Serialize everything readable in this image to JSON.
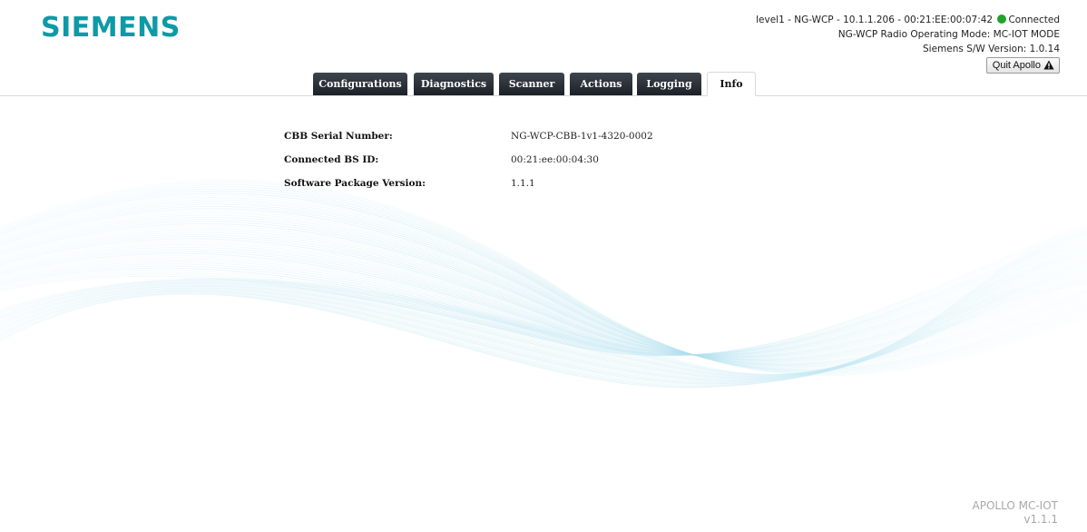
{
  "header": {
    "logo_text": "SIEMENS",
    "brand_color": "#0d9aa6",
    "connection_info": "level1 - NG-WCP - 10.1.1.206 - 00:21:EE:00:07:42",
    "connection_status": "Connected",
    "connection_status_color": "#1fa32a",
    "operating_mode": "NG-WCP Radio Operating Mode: MC-IOT MODE",
    "sw_version": "Siemens S/W Version: 1.0.14",
    "quit_label": "Quit Apollo"
  },
  "tabs": [
    {
      "label": "Configurations",
      "active": false
    },
    {
      "label": "Diagnostics",
      "active": false
    },
    {
      "label": "Scanner",
      "active": false
    },
    {
      "label": "Actions",
      "active": false
    },
    {
      "label": "Logging",
      "active": false
    },
    {
      "label": "Info",
      "active": true
    }
  ],
  "info": {
    "rows": [
      {
        "label": "CBB Serial Number:",
        "value": "NG-WCP-CBB-1v1-4320-0002"
      },
      {
        "label": "Connected BS ID:",
        "value": "00:21:ee:00:04:30"
      },
      {
        "label": "Software Package Version:",
        "value": "1.1.1"
      }
    ]
  },
  "footer": {
    "product": "APOLLO MC-IOT",
    "version": "v1.1.1"
  },
  "icons": {
    "status": "status-dot-icon",
    "quit": "warning-icon",
    "background": "wave-background"
  }
}
